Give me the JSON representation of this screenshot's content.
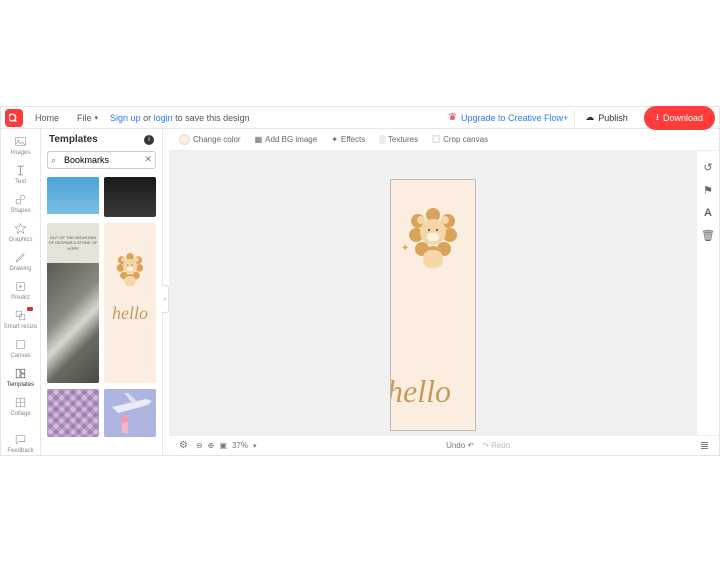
{
  "topbar": {
    "home": "Home",
    "file": "File",
    "signup": "Sign up",
    "or": " or ",
    "login": "login",
    "save_suffix": " to save this design",
    "upgrade": "Upgrade to Creative Flow+",
    "publish": "Publish",
    "download": "Download"
  },
  "rail": [
    {
      "label": "Images"
    },
    {
      "label": "Text"
    },
    {
      "label": "Shapes"
    },
    {
      "label": "Graphics"
    },
    {
      "label": "Drawing"
    },
    {
      "label": "Predict"
    },
    {
      "label": "Smart resize"
    },
    {
      "label": "Canvas"
    },
    {
      "label": "Templates"
    },
    {
      "label": "Collage"
    },
    {
      "label": "Feedback"
    }
  ],
  "panel": {
    "title": "Templates",
    "search_value": "Bookmarks",
    "mtn_text": "OUT OF THE\nMOUNTAIN OF DESPAIR\nA STONE OF HOPE"
  },
  "toolbar": {
    "change_color": "Change color",
    "add_bg": "Add BG image",
    "effects": "Effects",
    "textures": "Textures",
    "crop": "Crop canvas"
  },
  "canvas": {
    "hello": "hello"
  },
  "status": {
    "zoom": "37%",
    "undo": "Undo",
    "redo": "Redo"
  }
}
